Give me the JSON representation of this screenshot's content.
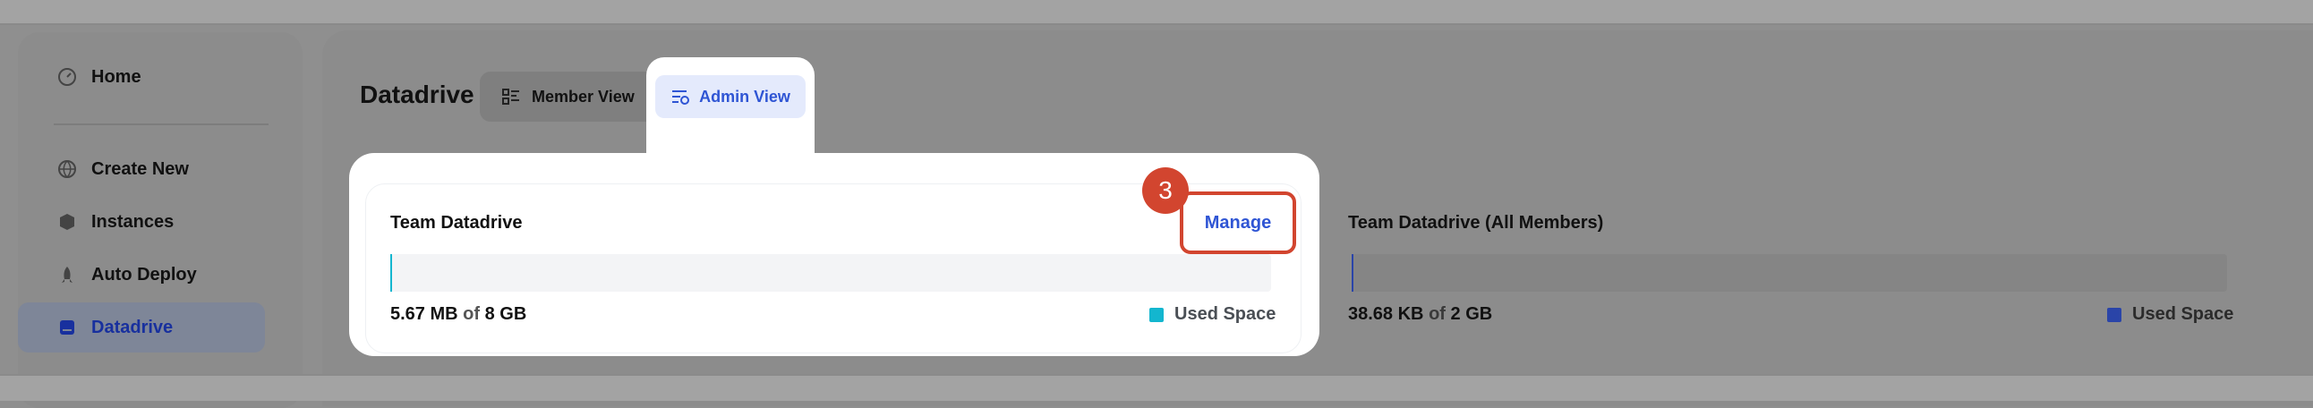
{
  "sidebar": {
    "items": [
      {
        "label": "Home",
        "icon": "gauge-icon"
      },
      {
        "label": "Create New",
        "icon": "globe-plus-icon"
      },
      {
        "label": "Instances",
        "icon": "cube-icon"
      },
      {
        "label": "Auto Deploy",
        "icon": "rocket-icon"
      },
      {
        "label": "Datadrive",
        "icon": "drive-icon",
        "active": true
      }
    ]
  },
  "header": {
    "title": "Datadrive",
    "tabs": {
      "member_view": "Member View",
      "admin_view": "Admin View"
    }
  },
  "team_card": {
    "title": "Team Datadrive",
    "manage_label": "Manage",
    "step_number": "3",
    "used": "5.67 MB",
    "of_label": "of",
    "total": "8 GB",
    "used_fraction": 0.0007,
    "legend_label": "Used Space",
    "color": "#13b6cf"
  },
  "members_card": {
    "title": "Team Datadrive (All Members)",
    "used": "38.68 KB",
    "of_label": "of",
    "total": "2 GB",
    "used_fraction": 2e-05,
    "legend_label": "Used Space",
    "color": "#2a44a8"
  },
  "colors": {
    "accent": "#2f55d4",
    "highlight": "#d2452f"
  }
}
